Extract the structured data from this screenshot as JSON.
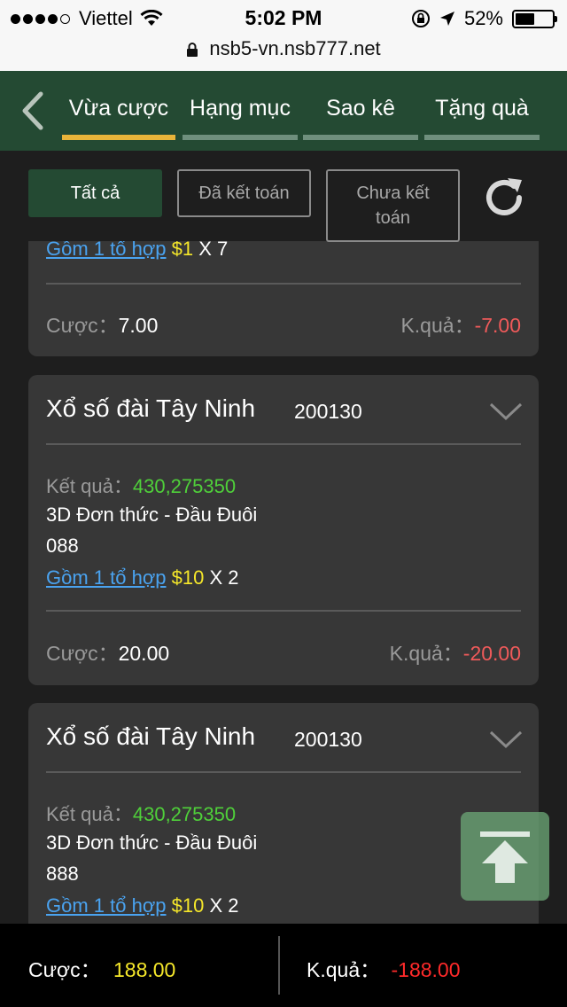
{
  "status_bar": {
    "carrier": "Viettel",
    "time": "5:02 PM",
    "battery": "52%",
    "battery_level": 0.52,
    "signal_bars_filled": 4,
    "signal_bars_total": 5
  },
  "browser": {
    "url": "nsb5-vn.nsb777.net"
  },
  "tabs": [
    {
      "label": "Vừa cược",
      "active": true
    },
    {
      "label": "Hạng mục",
      "active": false
    },
    {
      "label": "Sao kê",
      "active": false
    },
    {
      "label": "Tặng quà",
      "active": false
    }
  ],
  "filters": [
    {
      "label": "Tất cả",
      "active": true
    },
    {
      "label": "Đã kết toán",
      "active": false
    },
    {
      "label": "Chưa kết toán",
      "active": false
    }
  ],
  "labels": {
    "result": "Kết quả",
    "bet": "Cược",
    "outcome": "K.quả",
    "sep": "："
  },
  "cards": [
    {
      "combo_text": "Gồm 1 tổ hợp",
      "unit": "$1",
      "multiplier": "X 7",
      "bet": "7.00",
      "outcome": "-7.00"
    },
    {
      "title": "Xổ số đài Tây Ninh",
      "date": "200130",
      "result_numbers": "430,275350",
      "bet_type": "3D Đơn thức - Đầu Đuôi",
      "number": "088",
      "combo_text": "Gồm 1 tổ hợp",
      "unit": "$10",
      "multiplier": "X 2",
      "bet": "20.00",
      "outcome": "-20.00"
    },
    {
      "title": "Xổ số đài Tây Ninh",
      "date": "200130",
      "result_numbers": "430,275350",
      "bet_type": "3D Đơn thức - Đầu Đuôi",
      "number": "888",
      "combo_text": "Gồm 1 tổ hợp",
      "unit": "$10",
      "multiplier": "X 2"
    }
  ],
  "footer": {
    "bet_label": "Cược",
    "bet_value": "188.00",
    "outcome_label": "K.quả",
    "outcome_value": "-188.00",
    "sep": "："
  },
  "colors": {
    "header_bg": "#244a33",
    "tab_active_underline": "#e9b43a",
    "card_bg": "#373737",
    "positive": "#4fd03a",
    "amount": "#f5e72a",
    "negative": "#f05a5a",
    "link": "#4aa3f0"
  },
  "icons": [
    "wifi-icon",
    "lock-icon",
    "location-arrow-icon",
    "rotation-lock-icon",
    "back-chevron-icon",
    "refresh-icon",
    "chevron-down-icon",
    "scroll-to-top-icon"
  ]
}
